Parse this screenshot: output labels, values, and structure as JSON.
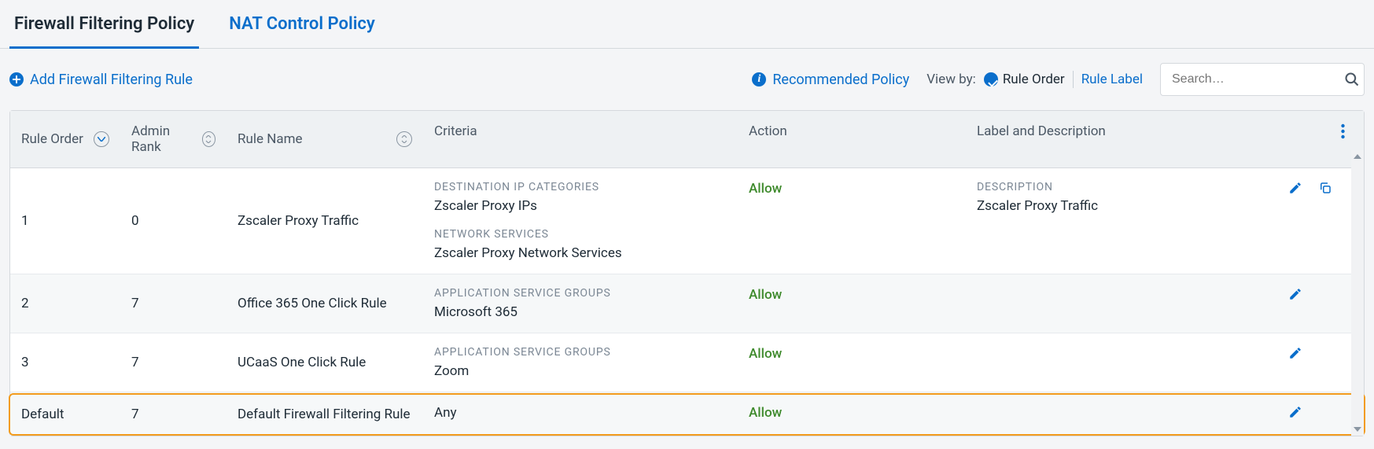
{
  "tabs": {
    "firewall": "Firewall Filtering Policy",
    "nat": "NAT Control Policy"
  },
  "toolbar": {
    "add_rule": "Add Firewall Filtering Rule",
    "recommended": "Recommended Policy",
    "view_by_label": "View by:",
    "view_by_order": "Rule Order",
    "view_by_label_opt": "Rule Label",
    "search_placeholder": "Search…"
  },
  "headers": {
    "order": "Rule Order",
    "rank": "Admin Rank",
    "name": "Rule Name",
    "criteria": "Criteria",
    "action": "Action",
    "label": "Label and Description"
  },
  "rows": [
    {
      "order": "1",
      "rank": "0",
      "name": "Zscaler Proxy Traffic",
      "criteria": [
        {
          "label": "DESTINATION IP CATEGORIES",
          "value": "Zscaler Proxy IPs"
        },
        {
          "label": "NETWORK SERVICES",
          "value": "Zscaler Proxy Network Services"
        }
      ],
      "action": "Allow",
      "desc_label": "DESCRIPTION",
      "desc_value": "Zscaler Proxy Traffic",
      "can_copy": true
    },
    {
      "order": "2",
      "rank": "7",
      "name": "Office 365 One Click Rule",
      "criteria": [
        {
          "label": "APPLICATION SERVICE GROUPS",
          "value": "Microsoft 365"
        }
      ],
      "action": "Allow",
      "desc_label": "",
      "desc_value": "",
      "can_copy": false
    },
    {
      "order": "3",
      "rank": "7",
      "name": "UCaaS One Click Rule",
      "criteria": [
        {
          "label": "APPLICATION SERVICE GROUPS",
          "value": "Zoom"
        }
      ],
      "action": "Allow",
      "desc_label": "",
      "desc_value": "",
      "can_copy": false
    },
    {
      "order": "Default",
      "rank": "7",
      "name": "Default Firewall Filtering Rule",
      "criteria_plain": "Any",
      "action": "Allow",
      "desc_label": "",
      "desc_value": "",
      "can_copy": false
    }
  ]
}
